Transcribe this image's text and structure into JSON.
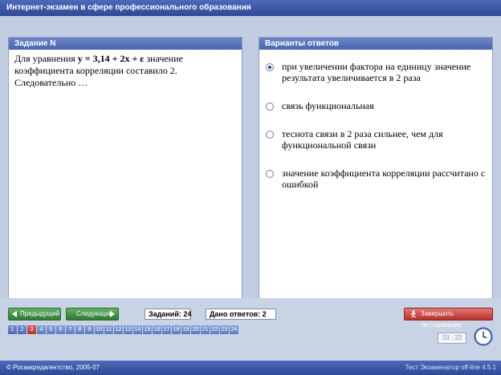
{
  "window": {
    "title": "Интернет-экзамен в сфере профессионального образования"
  },
  "question_panel": {
    "header": "Задание N",
    "text_before": "Для уравнения ",
    "equation": "y = 3,14 + 2x + ε",
    "text_after": " значение коэффициента корреляции составило 2. Следовательно …"
  },
  "answers_panel": {
    "header": "Варианты ответов",
    "options": [
      {
        "text": "при увеличении фактора на единицу значение результата увеличивается в 2 раза",
        "selected": true
      },
      {
        "text": "связь функциональная",
        "selected": false
      },
      {
        "text": "теснота связи в 2 раза сильнее, чем для функциональной связи",
        "selected": false
      },
      {
        "text": "значение коэффициента корреляции рассчитано с ошибкой",
        "selected": false
      }
    ]
  },
  "controls": {
    "prev_label": "Предыдущий",
    "next_label": "Следующий",
    "total_label": "Заданий: 24",
    "answered_label": "Дано ответов: 2",
    "finish_label": "Завершить тестирование"
  },
  "question_nav": {
    "numbers": [
      "1",
      "2",
      "3",
      "4",
      "5",
      "6",
      "7",
      "8",
      "9",
      "10",
      "11",
      "12",
      "13",
      "14",
      "15",
      "16",
      "17",
      "18",
      "19",
      "20",
      "21",
      "22",
      "23",
      "24"
    ],
    "current": "3"
  },
  "timer": {
    "display": "33 : 23"
  },
  "status": {
    "left": "© Росаккредагентство, 2005-07",
    "right": "Тест Экзаменатор off-line 4.5.1"
  },
  "colors": {
    "title_bar": "#2d4a97",
    "panel_header": "#4964ad",
    "nav_button": "#2f7a33",
    "finish_button": "#b5302d",
    "current_question": "#b3312c"
  }
}
